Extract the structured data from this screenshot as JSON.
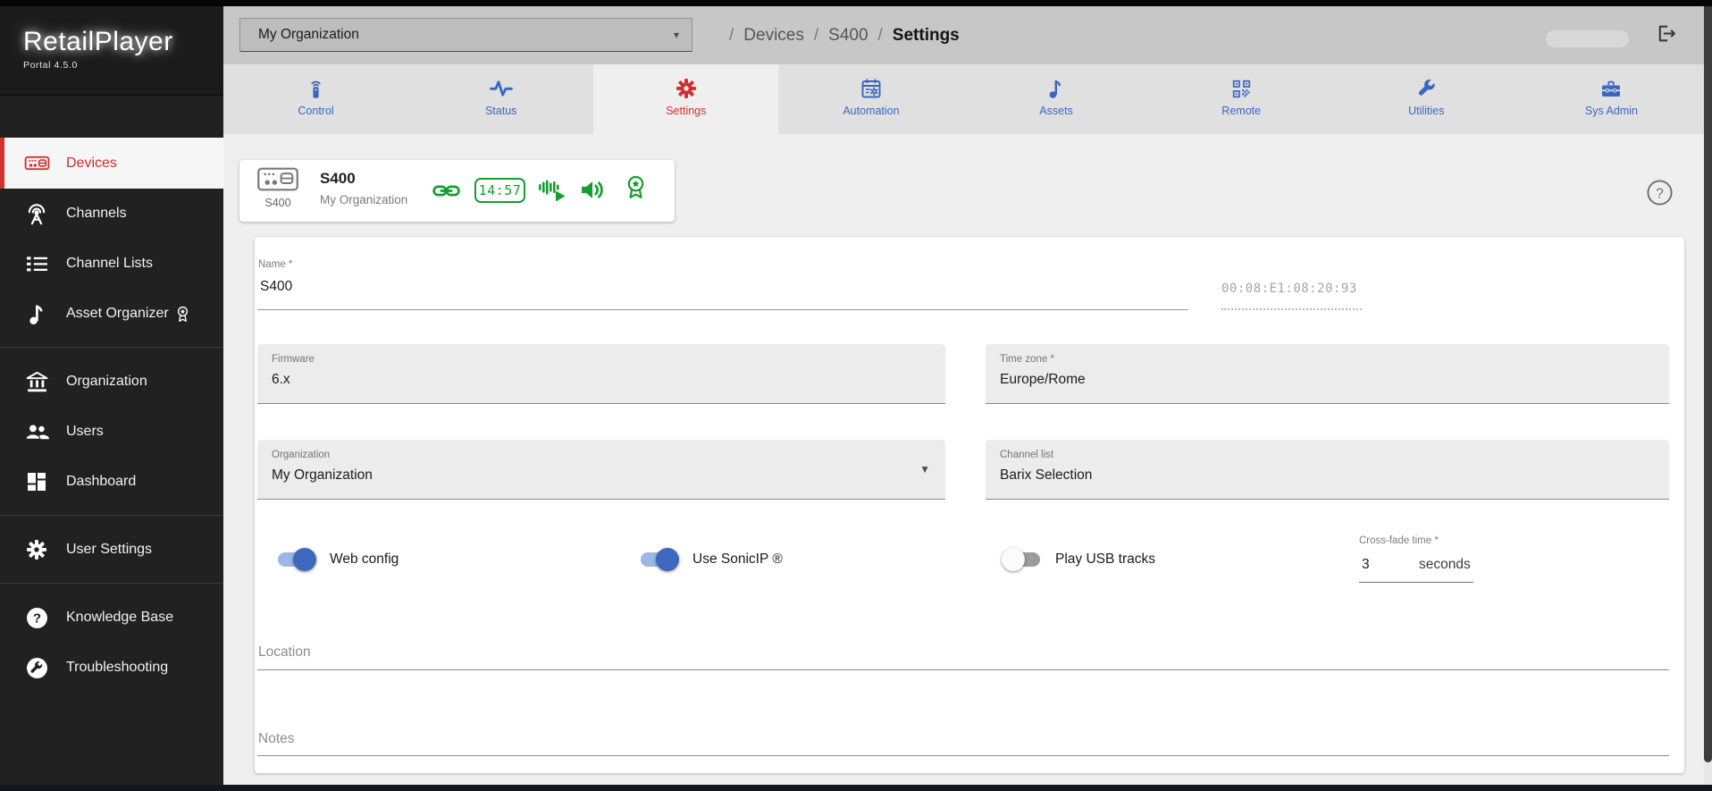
{
  "brand": {
    "title": "RetailPlayer",
    "subtitle": "Portal 4.5.0"
  },
  "header": {
    "org_select_value": "My Organization",
    "org_select_arrow": "▾",
    "breadcrumb": {
      "sep": "/",
      "items": [
        "Devices",
        "S400",
        "Settings"
      ]
    },
    "logout_icon": "logout-icon"
  },
  "tabs": [
    {
      "label": "Control",
      "icon": "remote-control-icon",
      "active": false
    },
    {
      "label": "Status",
      "icon": "pulse-icon",
      "active": false
    },
    {
      "label": "Settings",
      "icon": "gear-icon",
      "active": true
    },
    {
      "label": "Automation",
      "icon": "calendar-gear-icon",
      "active": false
    },
    {
      "label": "Assets",
      "icon": "music-note-icon",
      "active": false
    },
    {
      "label": "Remote",
      "icon": "qr-code-icon",
      "active": false
    },
    {
      "label": "Utilities",
      "icon": "wrench-icon",
      "active": false
    },
    {
      "label": "Sys Admin",
      "icon": "toolbox-icon",
      "active": false
    }
  ],
  "sidebar": {
    "items": [
      {
        "label": "Devices",
        "icon": "player-device-icon",
        "active": true
      },
      {
        "label": "Channels",
        "icon": "broadcast-icon",
        "active": false
      },
      {
        "label": "Channel Lists",
        "icon": "list-icon",
        "active": false
      },
      {
        "label": "Asset Organizer",
        "icon": "music-note-icon",
        "badge": "ribbon-badge-icon",
        "active": false
      },
      {
        "label": "Organization",
        "icon": "bank-icon",
        "active": false
      },
      {
        "label": "Users",
        "icon": "people-icon",
        "active": false
      },
      {
        "label": "Dashboard",
        "icon": "dashboard-icon",
        "active": false
      },
      {
        "label": "User Settings",
        "icon": "gear-icon",
        "active": false
      },
      {
        "label": "Knowledge Base",
        "icon": "question-circle-icon",
        "active": false
      },
      {
        "label": "Troubleshooting",
        "icon": "wrench-circle-icon",
        "active": false
      }
    ]
  },
  "device_card": {
    "device_type": "S400",
    "name": "S400",
    "organization": "My Organization",
    "clock": "14:57",
    "status_icons": [
      "link-icon",
      "clock-chip",
      "now-playing-icon",
      "speaker-icon",
      "ribbon-badge-icon"
    ]
  },
  "form": {
    "name_label": "Name *",
    "name_value": "S400",
    "mac_value": "00:08:E1:08:20:93",
    "firmware_label": "Firmware",
    "firmware_value": "6.x",
    "timezone_label": "Time zone *",
    "timezone_value": "Europe/Rome",
    "organization_label": "Organization",
    "organization_value": "My Organization",
    "channel_list_label": "Channel list",
    "channel_list_value": "Barix Selection",
    "toggles": [
      {
        "label": "Web config",
        "on": true
      },
      {
        "label": "Use SonicIP ®",
        "on": true
      },
      {
        "label": "Play USB tracks",
        "on": false
      }
    ],
    "crossfade_label": "Cross-fade time *",
    "crossfade_value": "3",
    "crossfade_suffix": "seconds",
    "location_label": "Location",
    "location_value": "",
    "notes_label": "Notes",
    "notes_value": ""
  },
  "colors": {
    "accent_blue": "#3a66c3",
    "accent_red": "#d32f2f",
    "status_green": "#149e2f",
    "toggle_on_knob": "#3e68bf",
    "toggle_on_track": "#9db6e3",
    "sidebar_bg": "#212121",
    "header_bg": "#c7c7c7"
  }
}
